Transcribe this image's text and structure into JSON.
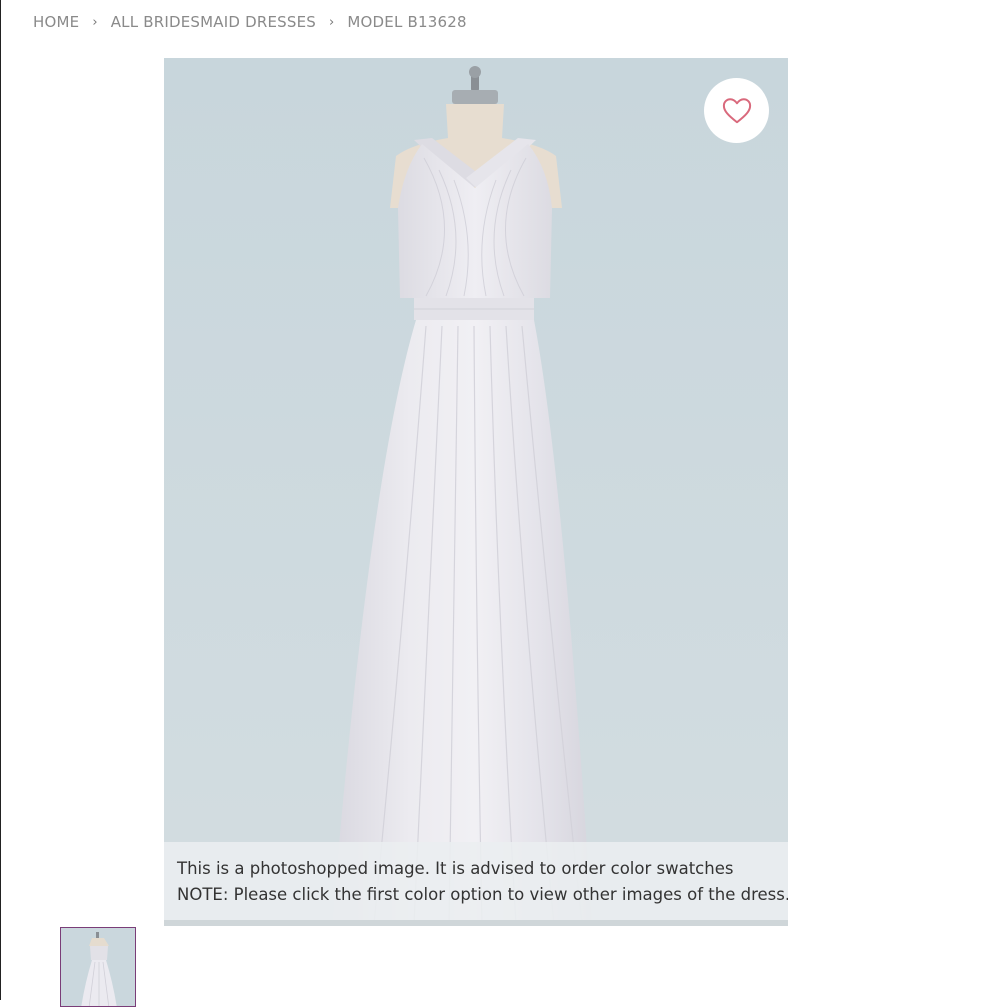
{
  "breadcrumb": {
    "items": [
      "HOME",
      "ALL BRIDESMAID DRESSES",
      "MODEL B13628"
    ],
    "separator": "›"
  },
  "product": {
    "notice_line1": "This is a photoshopped image. It is advised to order color swatches",
    "notice_line2": "NOTE: Please click the first color option to view other images of the dress.",
    "wishlist_icon": "heart-icon"
  },
  "colors": {
    "background": "#cbd8de",
    "heart": "#d9697c",
    "thumb_border": "#7a3d78",
    "crumb_text": "#8a8a8a"
  }
}
